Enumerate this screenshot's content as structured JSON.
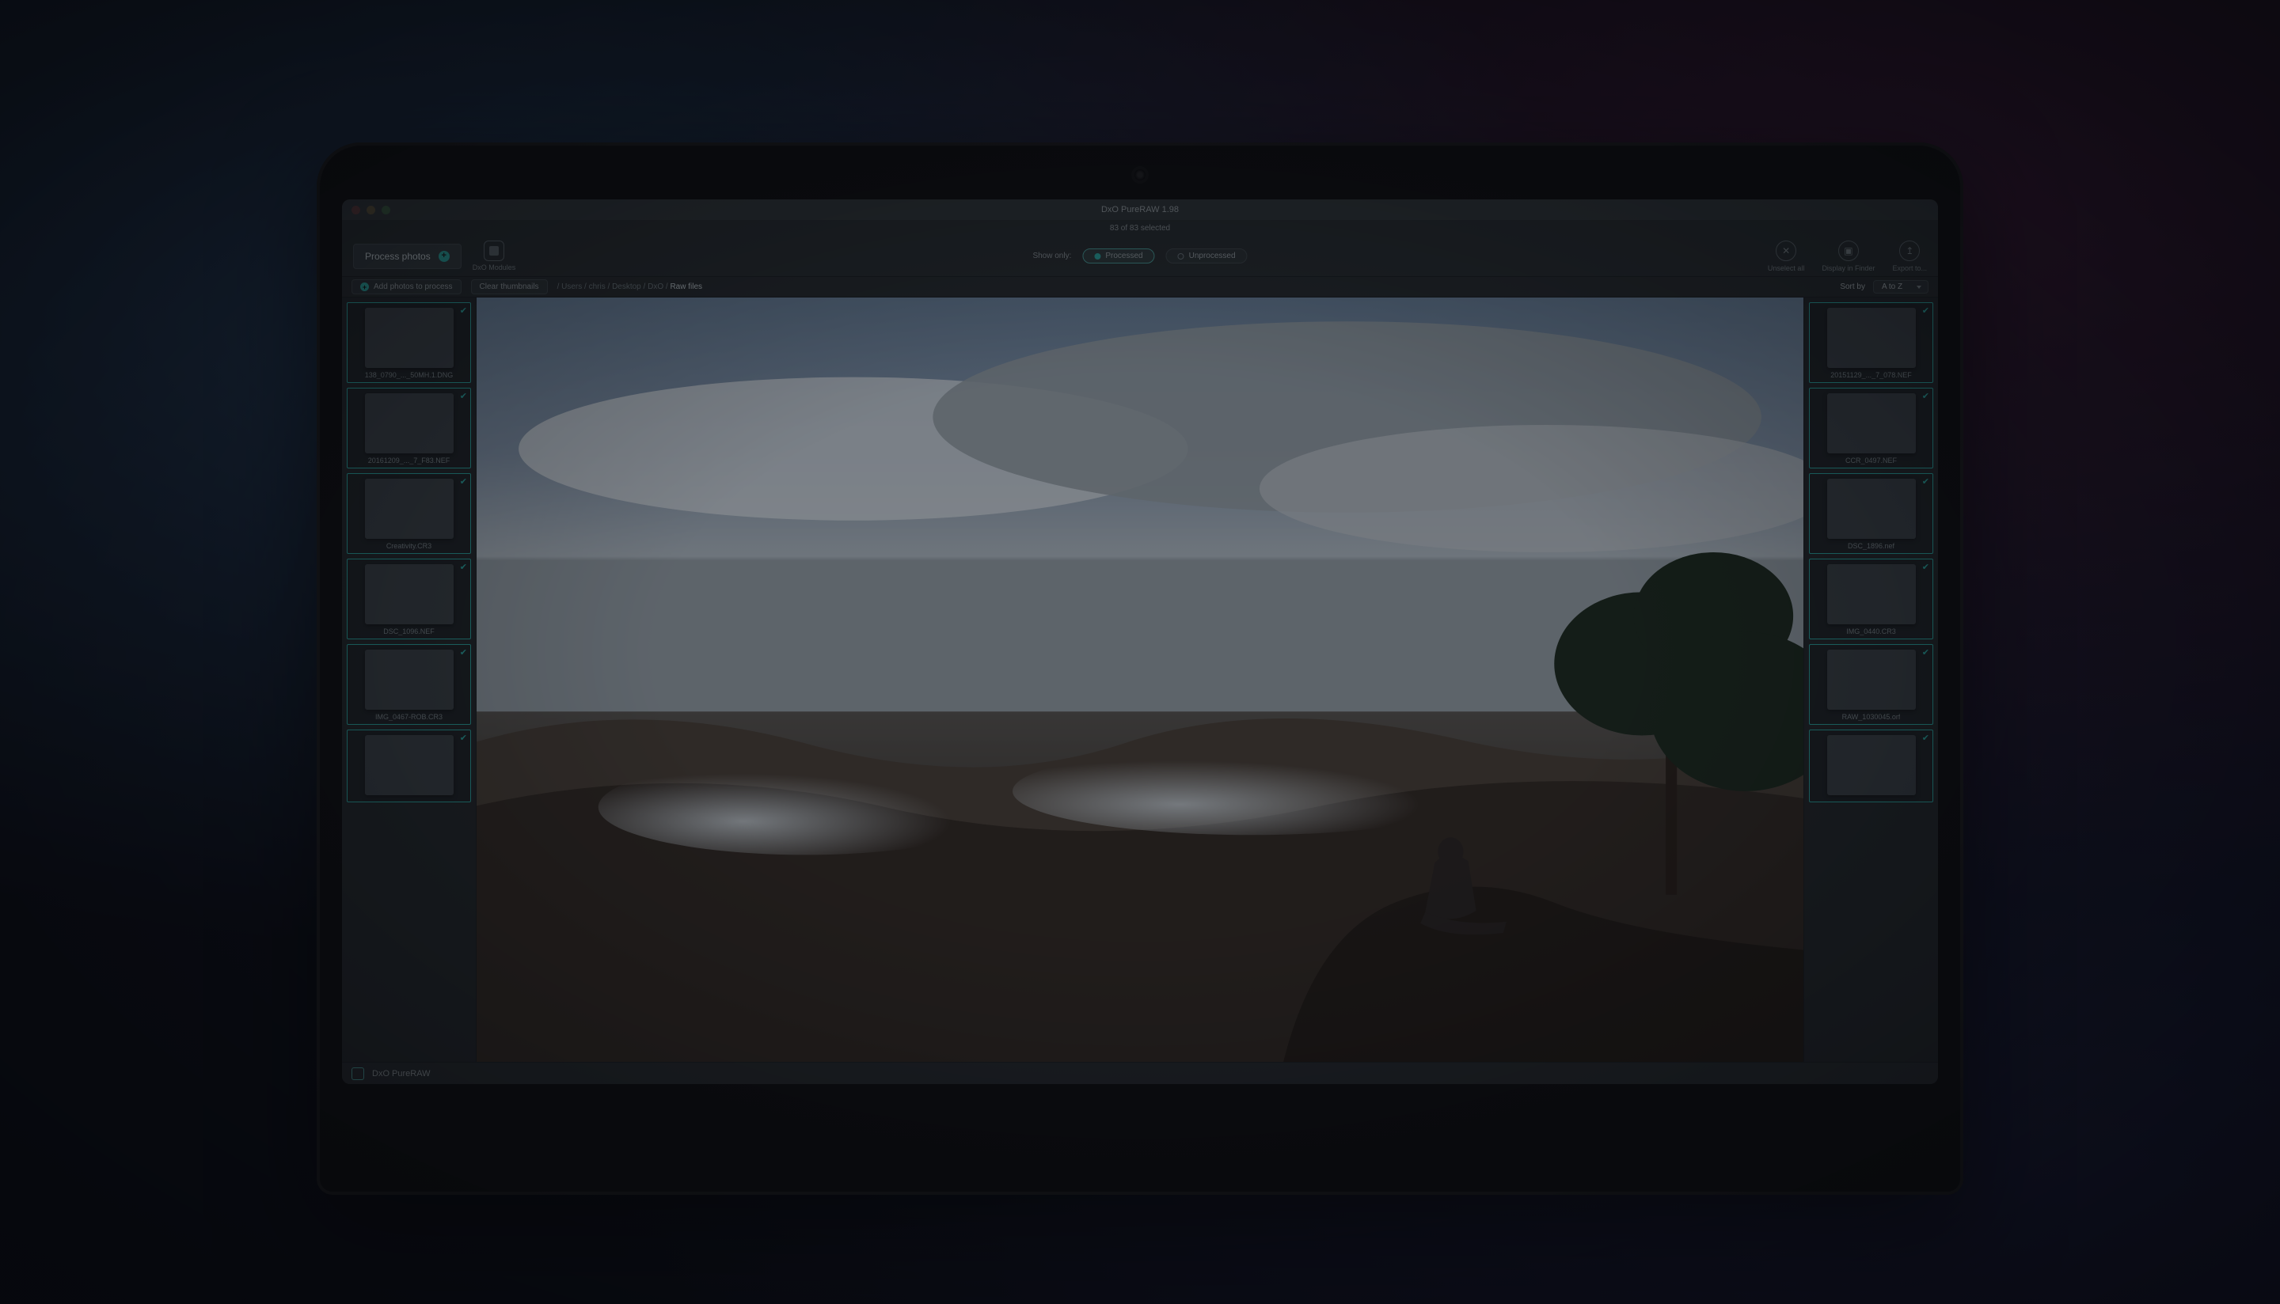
{
  "titlebar": {
    "title": "DxO PureRAW 1.98"
  },
  "sel_bar": "83 of 83 selected",
  "toolbar": {
    "process_label": "Process photos",
    "modules_label": "DxO Modules",
    "show_only": "Show only:",
    "chip_processed": "Processed",
    "chip_unprocessed": "Unprocessed",
    "unselect_all": "Unselect all",
    "display_finder": "Display in Finder",
    "export_to": "Export to..."
  },
  "subbar": {
    "add_photos": "Add photos to process",
    "clear_thumbs": "Clear thumbnails",
    "crumbs": [
      "Users",
      "chris",
      "Desktop",
      "DxO",
      "Raw files"
    ],
    "sort_by": "Sort by",
    "sort_value": "A to Z"
  },
  "thumbs_left": [
    {
      "fn": "138_0790_..._50MH.1.DNG",
      "cls": "t-city"
    },
    {
      "fn": "20161209_..._7_F83.NEF",
      "cls": "t-dark"
    },
    {
      "fn": "Creativity.CR3",
      "cls": "t-portrait"
    },
    {
      "fn": "DSC_1096.NEF",
      "cls": "t-stage"
    },
    {
      "fn": "IMG_0467-ROB.CR3",
      "cls": "t-wave"
    },
    {
      "fn": "",
      "cls": "t-people"
    }
  ],
  "thumbs_right": [
    {
      "fn": "20151129_..._7_078.NEF",
      "cls": "t-city"
    },
    {
      "fn": "CCR_0497.NEF",
      "cls": "t-plant"
    },
    {
      "fn": "DSC_1896.nef",
      "cls": "t-canyon"
    },
    {
      "fn": "IMG_0440.CR3",
      "cls": "t-orange"
    },
    {
      "fn": "RAW_1030045.orf",
      "cls": "t-moon"
    },
    {
      "fn": "",
      "cls": "t-bw"
    }
  ],
  "status": {
    "app": "DxO PureRAW"
  }
}
